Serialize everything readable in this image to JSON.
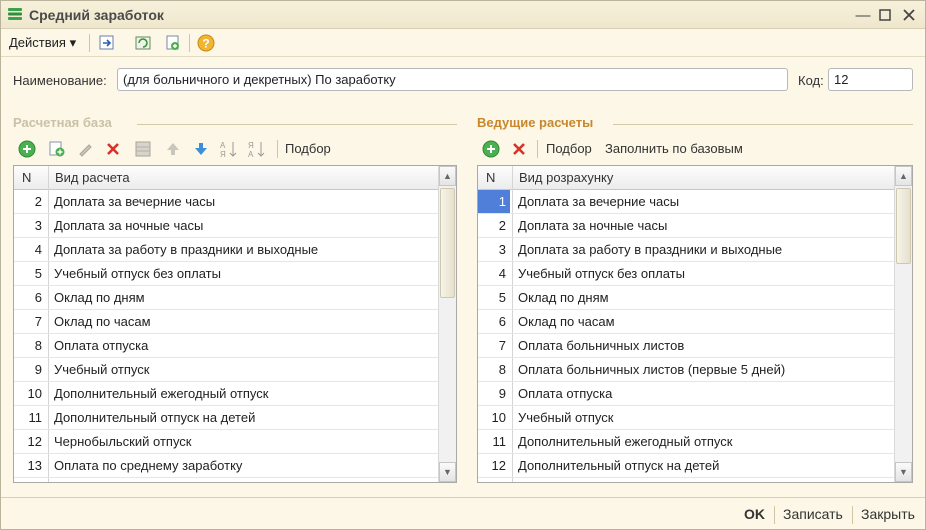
{
  "window": {
    "title": "Средний заработок",
    "minimize_icon": "minimize-icon",
    "maximize_icon": "maximize-icon",
    "close_icon": "close-icon"
  },
  "menu": {
    "actions_label": "Действия ▾",
    "icons": [
      "move-to-icon",
      "refresh-icon",
      "copy-icon",
      "help-icon"
    ]
  },
  "form": {
    "name_label": "Наименование:",
    "name_value": "(для больничного и декретных) По заработку",
    "code_label": "Код:",
    "code_value": "12"
  },
  "left": {
    "section_title": "Расчетная база",
    "toolbar_text": "Подбор",
    "col_n": "N",
    "col_name": "Вид расчета",
    "rows": [
      {
        "n": "2",
        "name": "Доплата за вечерние часы"
      },
      {
        "n": "3",
        "name": "Доплата за ночные часы"
      },
      {
        "n": "4",
        "name": "Доплата за работу в праздники и выходные"
      },
      {
        "n": "5",
        "name": "Учебный отпуск без оплаты"
      },
      {
        "n": "6",
        "name": "Оклад по дням"
      },
      {
        "n": "7",
        "name": "Оклад по часам"
      },
      {
        "n": "8",
        "name": "Оплата отпуска"
      },
      {
        "n": "9",
        "name": "Учебный отпуск"
      },
      {
        "n": "10",
        "name": "Дополнительный ежегодный отпуск"
      },
      {
        "n": "11",
        "name": "Дополнительный отпуск на детей"
      },
      {
        "n": "12",
        "name": "Чернобыльский отпуск"
      },
      {
        "n": "13",
        "name": "Оплата по среднему заработку"
      }
    ]
  },
  "right": {
    "section_title": "Ведущие расчеты",
    "toolbar_pick": "Подбор",
    "toolbar_fill": "Заполнить по базовым",
    "col_n": "N",
    "col_name": "Вид розрахунку",
    "rows": [
      {
        "n": "1",
        "name": "Доплата за вечерние часы"
      },
      {
        "n": "2",
        "name": "Доплата за ночные часы"
      },
      {
        "n": "3",
        "name": "Доплата за работу в праздники и выходные"
      },
      {
        "n": "4",
        "name": "Учебный отпуск без оплаты"
      },
      {
        "n": "5",
        "name": "Оклад по дням"
      },
      {
        "n": "6",
        "name": "Оклад по часам"
      },
      {
        "n": "7",
        "name": "Оплата больничных листов"
      },
      {
        "n": "8",
        "name": "Оплата больничных листов (первые 5 дней)"
      },
      {
        "n": "9",
        "name": "Оплата отпуска"
      },
      {
        "n": "10",
        "name": "Учебный отпуск"
      },
      {
        "n": "11",
        "name": "Дополнительный ежегодный отпуск"
      },
      {
        "n": "12",
        "name": "Дополнительный отпуск на детей"
      }
    ]
  },
  "footer": {
    "ok": "OK",
    "save": "Записать",
    "close": "Закрыть"
  },
  "colors": {
    "section_left": "#c9c2a8",
    "section_right": "#c8872d",
    "selected_cell": "#4f7fd8"
  }
}
